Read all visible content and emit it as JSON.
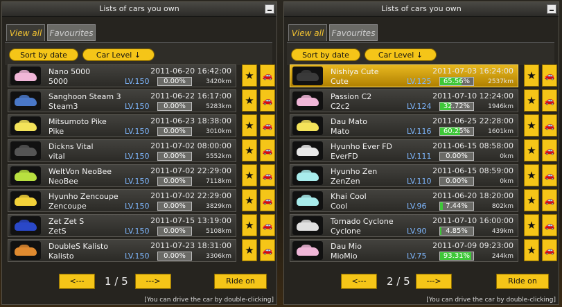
{
  "left": {
    "title": "Lists of cars you own",
    "tabs": [
      "View all",
      "Favourites"
    ],
    "sort_label": "Sort by date",
    "level_label": "Car Level ↓",
    "cars": [
      {
        "name": "Nano 5000",
        "short": "5000",
        "level": "LV.150",
        "date": "2011-06-20 16:42:00",
        "progress_label": "0.00%",
        "progress": 0,
        "km": "3420km",
        "color": "#f0b6d8"
      },
      {
        "name": "Sanghoon Steam 3",
        "short": "Steam3",
        "level": "LV.150",
        "date": "2011-06-22 16:17:00",
        "progress_label": "0.00%",
        "progress": 0,
        "km": "5283km",
        "color": "#4a78c8"
      },
      {
        "name": "Mitsumoto Pike",
        "short": "Pike",
        "level": "LV.150",
        "date": "2011-06-23 18:38:00",
        "progress_label": "0.00%",
        "progress": 0,
        "km": "3010km",
        "color": "#f3e35a"
      },
      {
        "name": "Dickns Vital",
        "short": "vital",
        "level": "LV.150",
        "date": "2011-07-02 08:00:00",
        "progress_label": "0.00%",
        "progress": 0,
        "km": "5552km",
        "color": "#555555"
      },
      {
        "name": "WeltVon NeoBee",
        "short": "NeoBee",
        "level": "LV.150",
        "date": "2011-07-02 22:29:00",
        "progress_label": "0.00%",
        "progress": 0,
        "km": "7118km",
        "color": "#b8e040"
      },
      {
        "name": "Hyunho Zencoupe",
        "short": "Zencoupe",
        "level": "LV.150",
        "date": "2011-07-02 22:29:00",
        "progress_label": "0.00%",
        "progress": 0,
        "km": "3829km",
        "color": "#f3d23a"
      },
      {
        "name": "Zet Zet S",
        "short": "ZetS",
        "level": "LV.150",
        "date": "2011-07-15 13:19:00",
        "progress_label": "0.00%",
        "progress": 0,
        "km": "5108km",
        "color": "#2a48c8"
      },
      {
        "name": "DoubleS Kalisto",
        "short": "Kalisto",
        "level": "LV.150",
        "date": "2011-07-23 18:31:00",
        "progress_label": "0.00%",
        "progress": 0,
        "km": "3306km",
        "color": "#e08a30"
      }
    ],
    "prev_label": "<---",
    "next_label": "--->",
    "page": "1 / 5",
    "ride_label": "Ride on",
    "hint": "[You can drive the car by double-clicking]"
  },
  "right": {
    "title": "Lists of cars you own",
    "tabs": [
      "View all",
      "Favourites"
    ],
    "sort_label": "Sort by date",
    "level_label": "Car Level ↓",
    "cars": [
      {
        "name": "Nishiya Cute",
        "short": "Cute",
        "level": "LV.125",
        "date": "2011-07-03 16:24:00",
        "progress_label": "65.56%",
        "progress": 65.56,
        "km": "2537km",
        "color": "#3a3a3a",
        "selected": true
      },
      {
        "name": "Passion C2",
        "short": "C2c2",
        "level": "LV.124",
        "date": "2011-07-10 12:24:00",
        "progress_label": "32.72%",
        "progress": 32.72,
        "km": "1946km",
        "color": "#f0b6d8"
      },
      {
        "name": "Dau Mato",
        "short": "Mato",
        "level": "LV.116",
        "date": "2011-06-25 22:28:00",
        "progress_label": "60.25%",
        "progress": 60.25,
        "km": "1601km",
        "color": "#f3e35a"
      },
      {
        "name": "Hyunho Ever FD",
        "short": "EverFD",
        "level": "LV.111",
        "date": "2011-06-15 08:58:00",
        "progress_label": "0.00%",
        "progress": 0,
        "km": "0km",
        "color": "#e8e8e8"
      },
      {
        "name": "Hyunho Zen",
        "short": "ZenZen",
        "level": "LV.110",
        "date": "2011-06-15 08:59:00",
        "progress_label": "0.00%",
        "progress": 0,
        "km": "0km",
        "color": "#a8ecec"
      },
      {
        "name": "Khai Cool",
        "short": "Cool",
        "level": "LV.96",
        "date": "2011-06-20 18:20:00",
        "progress_label": "7.44%",
        "progress": 7.44,
        "km": "802km",
        "color": "#a8ecec"
      },
      {
        "name": "Tornado Cyclone",
        "short": "Cyclone",
        "level": "LV.90",
        "date": "2011-07-10 16:00:00",
        "progress_label": "4.85%",
        "progress": 4.85,
        "km": "439km",
        "color": "#e0e0e0"
      },
      {
        "name": "Dau Mio",
        "short": "MioMio",
        "level": "LV.75",
        "date": "2011-07-09 09:23:00",
        "progress_label": "93.31%",
        "progress": 93.31,
        "km": "244km",
        "color": "#f0b6d8"
      }
    ],
    "prev_label": "<---",
    "next_label": "--->",
    "page": "2 / 5",
    "ride_label": "Ride on",
    "hint": "[You can drive the car by double-clicking]"
  },
  "icons": {
    "favourite": "star-icon",
    "drive": "car-icon",
    "minimize": "minimize-icon"
  },
  "colors": {
    "accent": "#f5c518",
    "progress": "#3ec838",
    "level": "#7fb8ff"
  }
}
